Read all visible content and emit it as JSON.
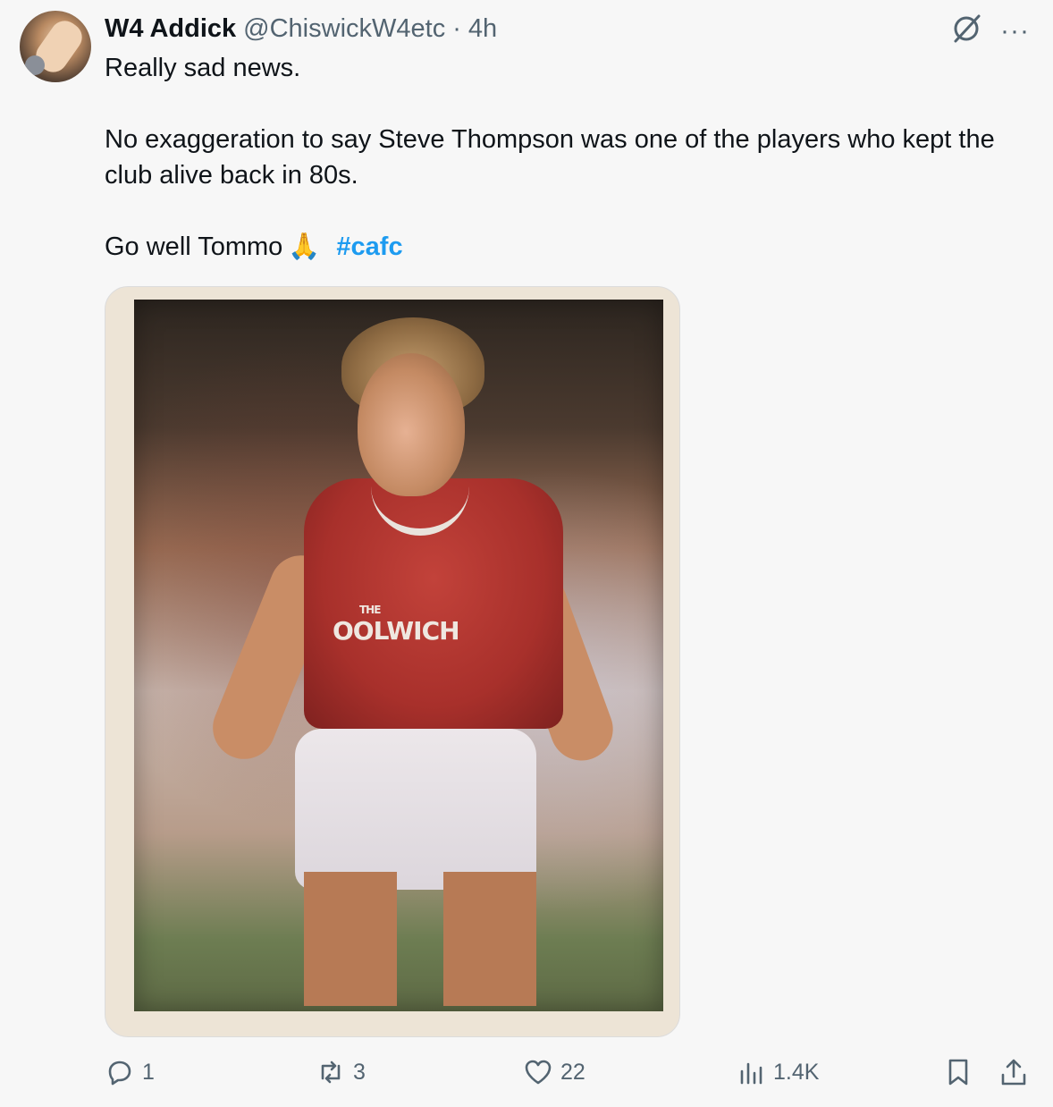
{
  "tweet": {
    "display_name": "W4 Addick",
    "handle": "@ChiswickW4etc",
    "separator": "·",
    "time": "4h",
    "text_line1": "Really sad news.",
    "text_para2": "No exaggeration to say Steve Thompson was one of the players who kept the club alive back in 80s.",
    "text_line3": "Go well Tommo",
    "emoji": "🙏",
    "hashtag": "#cafc",
    "more_label": "···"
  },
  "media": {
    "sponsor_small": "THE",
    "sponsor_text": "OOLWICH"
  },
  "actions": {
    "replies": "1",
    "reposts": "3",
    "likes": "22",
    "views": "1.4K"
  },
  "colors": {
    "link": "#1d9bf0",
    "muted": "#536471",
    "text": "#0f1419",
    "background": "#f7f7f7"
  },
  "icons": [
    "grok-icon",
    "more-icon",
    "reply-icon",
    "repost-icon",
    "like-icon",
    "views-icon",
    "bookmark-icon",
    "share-icon"
  ]
}
